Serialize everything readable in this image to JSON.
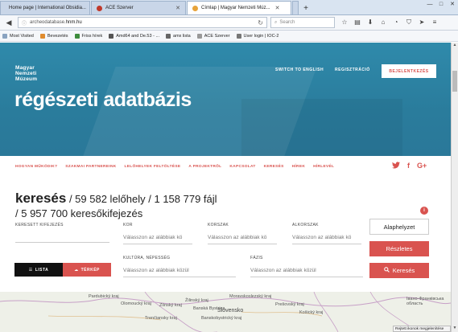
{
  "browser": {
    "tabs": [
      {
        "label": "Home page | International Obsidia...",
        "active": false
      },
      {
        "label": "ACE Szerver",
        "active": false
      },
      {
        "label": "Címlap | Magyar Nemzeti Múz...",
        "active": true
      },
      {
        "label": "",
        "active": false
      }
    ],
    "url_host": "archeodatabase.",
    "url_domain": "hnm.hu",
    "search_placeholder": "Search",
    "bookmarks": [
      "Most Visited",
      "Bevezetés",
      "Friss hírek",
      "Amd64 and De.53 - ...",
      "amx lista",
      "ACE Szerver",
      "User login | IOC-2"
    ]
  },
  "site": {
    "logo_lines": [
      "Magyar",
      "Nemzeti",
      "Múzeum"
    ],
    "switch_language": "SWITCH TO ENGLISH",
    "register": "REGISZTRÁCIÓ",
    "login": "BEJELENTKEZÉS",
    "hero_title": "régészeti adatbázis",
    "menu": [
      "HOGYAN MŰKÖDIK?",
      "SZAKMAI PARTNEREINK",
      "LELŐHELYEK FELTÖLTÉSE",
      "A PROJEKTRŐL",
      "KAPCSOLAT",
      "KERESÉS",
      "HÍREK",
      "HÍRLEVÉL"
    ],
    "social": [
      "twitter-icon",
      "facebook-icon",
      "googleplus-icon"
    ]
  },
  "search": {
    "heading": "keresés",
    "stats_line1": " / 59 582 lelőhely / 1 158 779 fájl",
    "stats_line2": "/ 5 957 700 keresőkifejezés",
    "info_label": "i",
    "fields": {
      "keyword_label": "KERESETT KIFEJEZÉS",
      "kor_label": "KOR",
      "korszak_label": "KORSZAK",
      "alkorszak_label": "ALKORSZAK",
      "kultura_label": "KULTÚRA, NÉPESSÉG",
      "fazis_label": "FÁZIS",
      "kor_placeholder": "Válasszon az alábbiak kö",
      "korszak_placeholder": "Válasszon az alábbiak kö",
      "alkorszak_placeholder": "Válasszon az alábbiak kö",
      "kultura_placeholder": "Válasszon az alábbiak közül",
      "fazis_placeholder": "Válasszon az alábbiak közül"
    },
    "reset_button": "Alaphelyzet",
    "details_button": "Részletes",
    "search_button": "Keresés",
    "view_list": "LISTA",
    "view_map": "TÉRKÉP"
  },
  "map": {
    "labels": [
      "Pardubický kraj",
      "Olomoucký kraj",
      "Moravskoslezský kraj",
      "Zlínský kraj",
      "Banská Bystrica",
      "Slovensko",
      "Prešovský kraj",
      "Košický kraj",
      "Івано-Франківська область",
      "Žilinský kraj",
      "Banskobystrický kraj",
      "Trenčiansky kraj"
    ]
  },
  "status_text": "Rejtett ikonok megjelenítése",
  "colors": {
    "accent": "#d9534f",
    "hero": "#2a7c9c"
  }
}
